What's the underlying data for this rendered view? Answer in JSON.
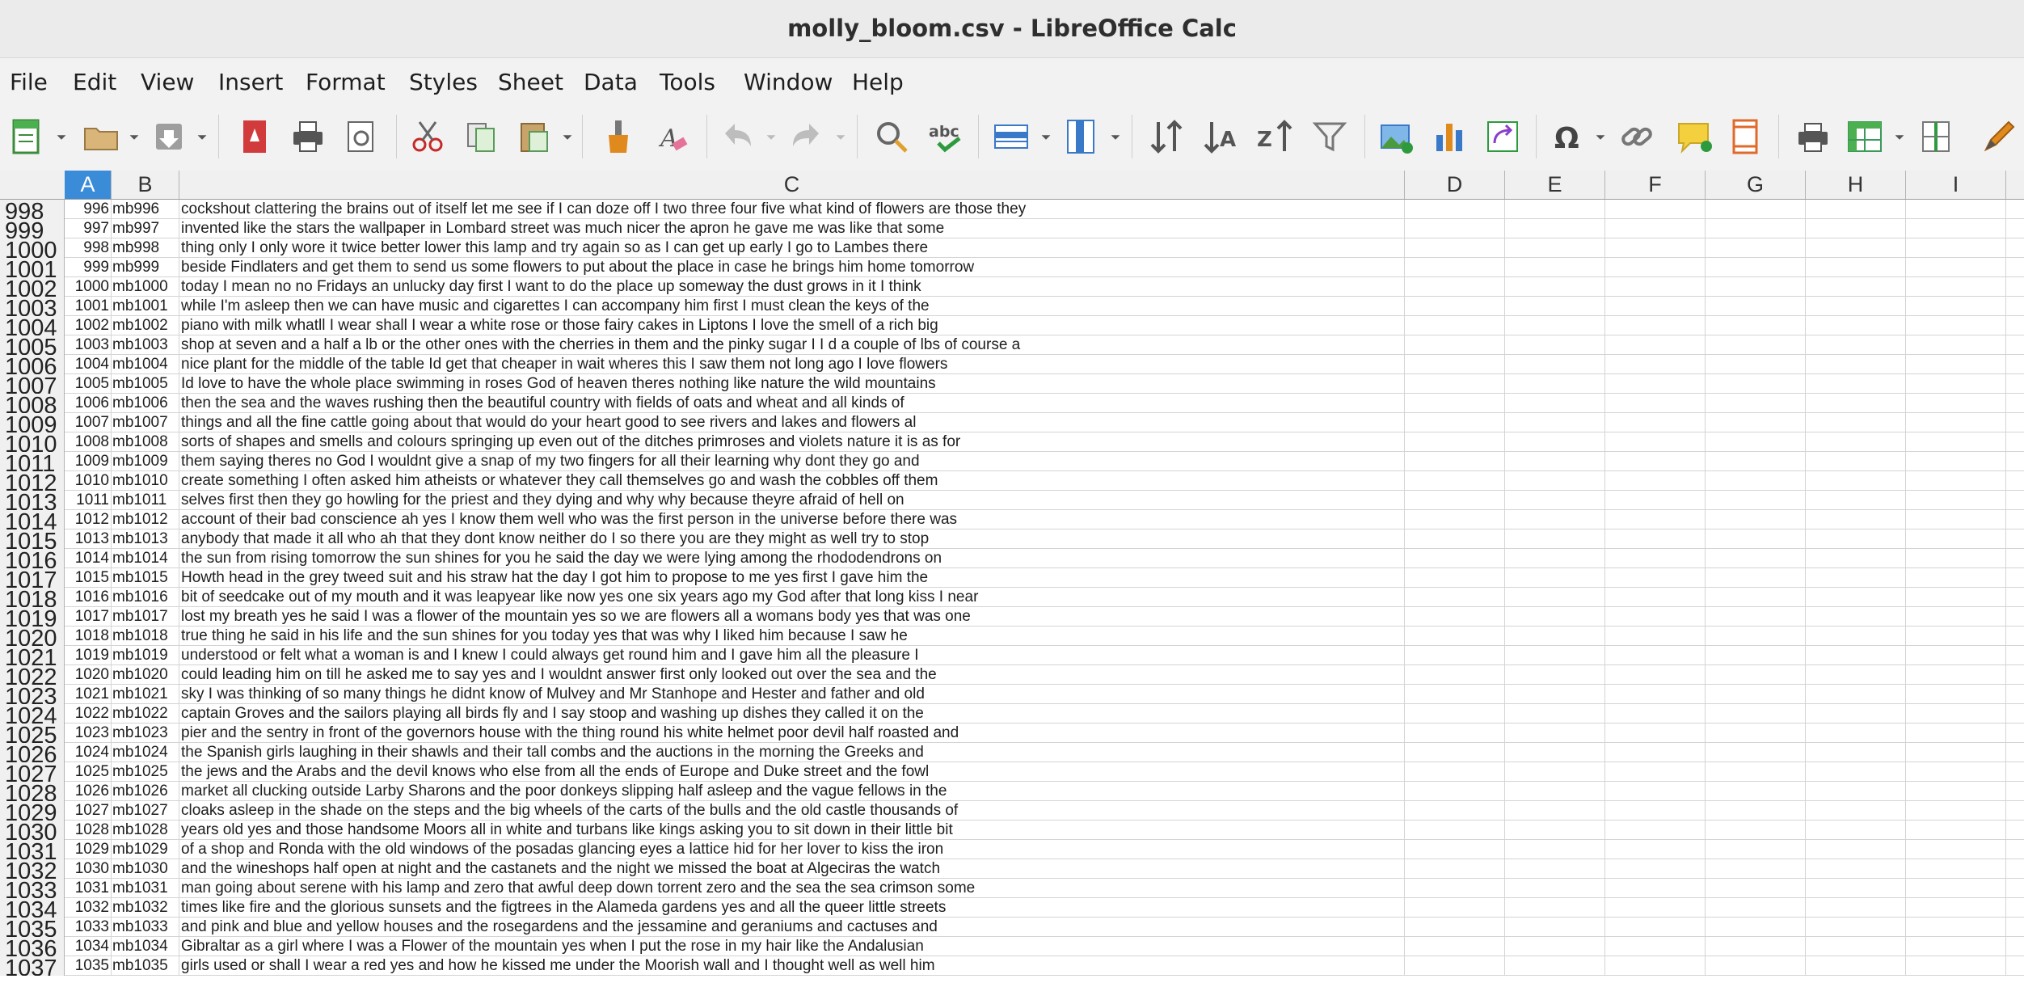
{
  "window": {
    "title": "molly_bloom.csv - LibreOffice Calc"
  },
  "menu": [
    "File",
    "Edit",
    "View",
    "Insert",
    "Format",
    "Styles",
    "Sheet",
    "Data",
    "Tools",
    "Window",
    "Help"
  ],
  "toolbar_icons": [
    "new-spreadsheet",
    "open",
    "save",
    "export-pdf",
    "print",
    "print-preview",
    "cut",
    "copy",
    "paste",
    "clone-formatting",
    "clear-formatting",
    "undo",
    "redo",
    "spelling",
    "autospell",
    "rows",
    "columns",
    "sort",
    "sort-ascending",
    "sort-descending",
    "autofilter",
    "insert-image",
    "insert-chart",
    "pivot-table",
    "special-character",
    "hyperlink",
    "comment",
    "headers-footers",
    "print-area",
    "freeze-rows-columns",
    "split-window",
    "define-print-area"
  ],
  "columns": [
    "A",
    "B",
    "C",
    "D",
    "E",
    "F",
    "G",
    "H",
    "I"
  ],
  "selected_column": "A",
  "colors": {
    "selected_header": "#3a8bd8",
    "header_bg": "#f0f0f0",
    "grid_line": "#d4d4d4"
  },
  "rows": [
    {
      "row": "998",
      "a": "996",
      "b": "mb996",
      "c": "cockshout clattering the brains out of itself let me see if I can doze off I two three four five what kind of flowers are those they"
    },
    {
      "row": "999",
      "a": "997",
      "b": "mb997",
      "c": "invented like the stars the wallpaper in Lombard street was much nicer the apron he gave me was like that some"
    },
    {
      "row": "1000",
      "a": "998",
      "b": "mb998",
      "c": "thing only I only wore it twice better lower this lamp and try again so as I can get up early I go to Lambes there"
    },
    {
      "row": "1001",
      "a": "999",
      "b": "mb999",
      "c": "beside Findlaters and get them to send us some flowers to put about the place in case he brings him home tomorrow"
    },
    {
      "row": "1002",
      "a": "1000",
      "b": "mb1000",
      "c": "today I mean no no Fridays an unlucky day first I want to do the place up someway the dust grows in it I think"
    },
    {
      "row": "1003",
      "a": "1001",
      "b": "mb1001",
      "c": "while I'm asleep then we can have music and cigarettes I can accompany him first I must clean the keys of the"
    },
    {
      "row": "1004",
      "a": "1002",
      "b": "mb1002",
      "c": "piano with milk whatll I wear shall I wear a white rose or those fairy cakes in Liptons I love the smell of a rich big"
    },
    {
      "row": "1005",
      "a": "1003",
      "b": "mb1003",
      "c": "shop at seven and a half a lb or the other ones with the cherries in them and the pinky sugar I I d a couple of lbs of course a"
    },
    {
      "row": "1006",
      "a": "1004",
      "b": "mb1004",
      "c": "nice plant for the middle of the table Id get that cheaper in wait wheres this I saw them not long ago I love flowers"
    },
    {
      "row": "1007",
      "a": "1005",
      "b": "mb1005",
      "c": "Id love to have the whole place swimming in roses God of heaven theres nothing like nature the wild mountains"
    },
    {
      "row": "1008",
      "a": "1006",
      "b": "mb1006",
      "c": "then the sea and the waves rushing then the beautiful country with fields of oats and wheat and all kinds of"
    },
    {
      "row": "1009",
      "a": "1007",
      "b": "mb1007",
      "c": "things and all the fine cattle going about that would do your heart good to see rivers and lakes and flowers al"
    },
    {
      "row": "1010",
      "a": "1008",
      "b": "mb1008",
      "c": "sorts of shapes and smells and colours springing up even out of the ditches primroses and violets nature it is as for"
    },
    {
      "row": "1011",
      "a": "1009",
      "b": "mb1009",
      "c": "them saying theres no God I wouldnt give a snap of my two fingers for all their learning why dont they go and"
    },
    {
      "row": "1012",
      "a": "1010",
      "b": "mb1010",
      "c": "create something I often asked him atheists or whatever they call themselves go and wash the cobbles off them"
    },
    {
      "row": "1013",
      "a": "1011",
      "b": "mb1011",
      "c": "selves first then they go howling for the priest and they dying and why why because theyre afraid of hell on"
    },
    {
      "row": "1014",
      "a": "1012",
      "b": "mb1012",
      "c": "account of their bad conscience ah yes I know them well who was the first person in the universe before there was"
    },
    {
      "row": "1015",
      "a": "1013",
      "b": "mb1013",
      "c": "anybody that made it all who ah that they dont know neither do I so there you are they might as well try to stop"
    },
    {
      "row": "1016",
      "a": "1014",
      "b": "mb1014",
      "c": "the sun from rising tomorrow the sun shines for you he said the day we were lying among the rhododendrons on"
    },
    {
      "row": "1017",
      "a": "1015",
      "b": "mb1015",
      "c": "Howth head in the grey tweed suit and his straw hat the day I got him to propose to me yes first I gave him the"
    },
    {
      "row": "1018",
      "a": "1016",
      "b": "mb1016",
      "c": "bit of seedcake out of my mouth and it was leapyear like now yes one six years ago my God after that long kiss I near"
    },
    {
      "row": "1019",
      "a": "1017",
      "b": "mb1017",
      "c": "lost my breath yes he said I was a flower of the mountain yes so we are flowers all a womans body yes that was one"
    },
    {
      "row": "1020",
      "a": "1018",
      "b": "mb1018",
      "c": "true thing he said in his life and the sun shines for you today yes that was why I liked him because I saw he"
    },
    {
      "row": "1021",
      "a": "1019",
      "b": "mb1019",
      "c": "understood or felt what a woman is and I knew I could always get round him and I gave him all the pleasure I"
    },
    {
      "row": "1022",
      "a": "1020",
      "b": "mb1020",
      "c": "could leading him on till he asked me to say yes and I wouldnt answer first only looked out over the sea and the"
    },
    {
      "row": "1023",
      "a": "1021",
      "b": "mb1021",
      "c": "sky I was thinking of so many things he didnt know of Mulvey and Mr Stanhope and Hester and father and old"
    },
    {
      "row": "1024",
      "a": "1022",
      "b": "mb1022",
      "c": "captain Groves and the sailors playing all birds fly and I say stoop and washing up dishes they called it on the"
    },
    {
      "row": "1025",
      "a": "1023",
      "b": "mb1023",
      "c": "pier and the sentry in front of the governors house with the thing round his white helmet poor devil half roasted and"
    },
    {
      "row": "1026",
      "a": "1024",
      "b": "mb1024",
      "c": "the Spanish girls laughing in their shawls and their tall combs and the auctions in the morning the Greeks and"
    },
    {
      "row": "1027",
      "a": "1025",
      "b": "mb1025",
      "c": "the jews and the Arabs and the devil knows who else from all the ends of Europe and Duke street and the fowl"
    },
    {
      "row": "1028",
      "a": "1026",
      "b": "mb1026",
      "c": "market all clucking outside Larby Sharons and the poor donkeys slipping half asleep and the vague fellows in the"
    },
    {
      "row": "1029",
      "a": "1027",
      "b": "mb1027",
      "c": "cloaks asleep in the shade on the steps and the big wheels of the carts of the bulls and the old castle thousands of"
    },
    {
      "row": "1030",
      "a": "1028",
      "b": "mb1028",
      "c": "years old yes and those handsome Moors all in white and turbans like kings asking you to sit down in their little bit"
    },
    {
      "row": "1031",
      "a": "1029",
      "b": "mb1029",
      "c": "of a shop and Ronda with the old windows of the posadas glancing eyes a lattice hid for her lover to kiss the iron"
    },
    {
      "row": "1032",
      "a": "1030",
      "b": "mb1030",
      "c": "and the wineshops half open at night and the castanets and the night we missed the boat at Algeciras the watch"
    },
    {
      "row": "1033",
      "a": "1031",
      "b": "mb1031",
      "c": "man going about serene with his lamp and zero that awful deep down torrent zero and the sea the sea crimson some"
    },
    {
      "row": "1034",
      "a": "1032",
      "b": "mb1032",
      "c": "times like fire and the glorious sunsets and the figtrees in the Alameda gardens yes and all the queer little streets"
    },
    {
      "row": "1035",
      "a": "1033",
      "b": "mb1033",
      "c": "and pink and blue and yellow houses and the rosegardens and the jessamine and geraniums and cactuses and"
    },
    {
      "row": "1036",
      "a": "1034",
      "b": "mb1034",
      "c": "Gibraltar as a girl where I was a Flower of the mountain yes when I put the rose in my hair like the Andalusian"
    },
    {
      "row": "1037",
      "a": "1035",
      "b": "mb1035",
      "c": "girls used or shall I wear a red yes and how he kissed me under the Moorish wall and I thought well as well him"
    }
  ]
}
